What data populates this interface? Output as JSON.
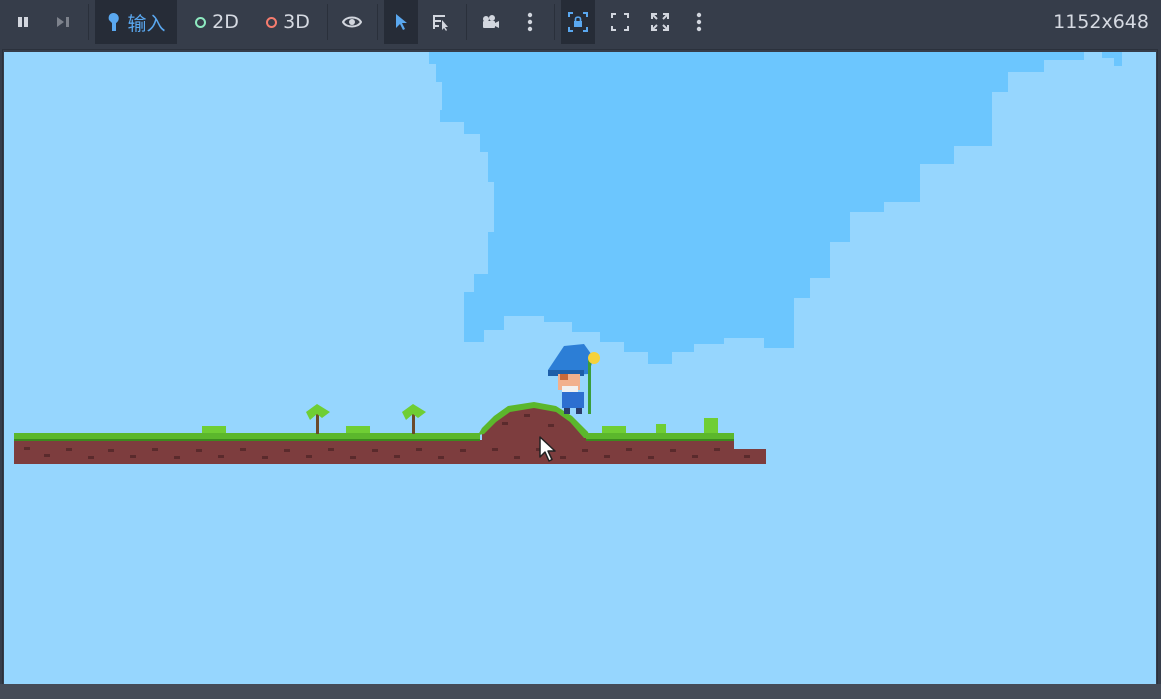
{
  "toolbar": {
    "input_label": "输入",
    "mode_2d_label": "2D",
    "mode_3d_label": "3D",
    "resolution": "1152x648"
  },
  "colors": {
    "toolbar_bg": "#363d4a",
    "accent": "#5aa8f0",
    "sky": "#96d6fe",
    "cloud": "#6cc6fe",
    "grass": "#57b42a",
    "dirt": "#7a3a3a"
  }
}
